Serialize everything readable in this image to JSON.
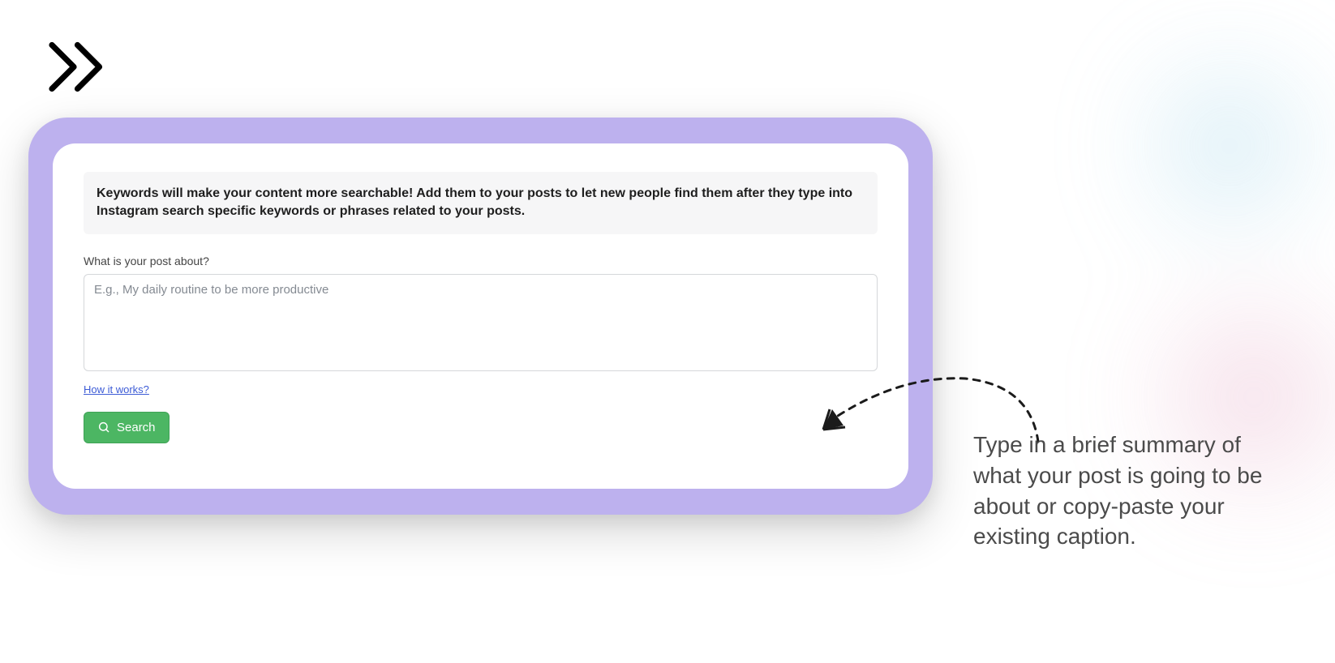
{
  "info": {
    "text": "Keywords will make your content more searchable! Add them to your posts to let new people find them after they type into Instagram search specific keywords or phrases related to your posts."
  },
  "form": {
    "label": "What is your post about?",
    "placeholder": "E.g., My daily routine to be more productive",
    "value": "",
    "how_it_works": "How it works?",
    "search_label": "Search"
  },
  "annotation": {
    "text": "Type in a brief summary of what your post is going to be about or copy-paste your existing caption."
  }
}
